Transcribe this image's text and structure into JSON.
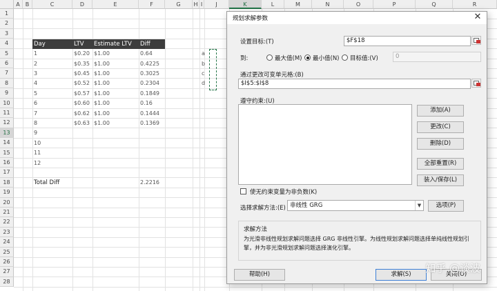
{
  "sheet": {
    "columns": [
      "A",
      "B",
      "C",
      "D",
      "E",
      "F",
      "G",
      "H",
      "I",
      "J",
      "K",
      "L",
      "M",
      "N",
      "O",
      "P",
      "Q",
      "R"
    ],
    "active_column": "K",
    "rows": [
      "1",
      "2",
      "3",
      "4",
      "5",
      "6",
      "7",
      "8",
      "9",
      "10",
      "11",
      "12",
      "13",
      "14",
      "15",
      "16",
      "17",
      "18",
      "19",
      "20",
      "21",
      "22",
      "23",
      "24",
      "25",
      "26",
      "27",
      "28"
    ],
    "active_row": "13",
    "table_headers": [
      "Day",
      "LTV",
      "Estimate LTV",
      "Diff"
    ],
    "table_rows": [
      [
        "1",
        "$0.20",
        "$1.00",
        "0.64"
      ],
      [
        "2",
        "$0.35",
        "$1.00",
        "0.4225"
      ],
      [
        "3",
        "$0.45",
        "$1.00",
        "0.3025"
      ],
      [
        "4",
        "$0.52",
        "$1.00",
        "0.2304"
      ],
      [
        "5",
        "$0.57",
        "$1.00",
        "0.1849"
      ],
      [
        "6",
        "$0.60",
        "$1.00",
        "0.16"
      ],
      [
        "7",
        "$0.62",
        "$1.00",
        "0.1444"
      ],
      [
        "8",
        "$0.63",
        "$1.00",
        "0.1369"
      ],
      [
        "9",
        "",
        "",
        ""
      ],
      [
        "10",
        "",
        "",
        ""
      ],
      [
        "11",
        "",
        "",
        ""
      ],
      [
        "12",
        "",
        "",
        ""
      ]
    ],
    "total_label": "Total Diff",
    "total_value": "2.2216",
    "param_labels": [
      "a",
      "b",
      "c",
      "d"
    ]
  },
  "dialog": {
    "title": "规划求解参数",
    "close_glyph": "✕",
    "set_objective_label": "设置目标:(T)",
    "set_objective_value": "$F$18",
    "to_label": "到:",
    "radio_max": "最大值(M)",
    "radio_min": "最小值(N)",
    "radio_value": "目标值:(V)",
    "selected_radio": "min",
    "target_value": "0",
    "changing_cells_label": "通过更改可变单元格:(B)",
    "changing_cells_value": "$I$5:$I$8",
    "constraints_label": "遵守约束:(U)",
    "btn_add": "添加(A)",
    "btn_change": "更改(C)",
    "btn_delete": "删除(D)",
    "btn_reset": "全部重置(R)",
    "btn_load_save": "装入/保存(L)",
    "nonneg_label": "使无约束变量为非负数(K)",
    "nonneg_checked": false,
    "method_label": "选择求解方法:(E)",
    "method_value": "非线性 GRG",
    "btn_options": "选项(P)",
    "method_group_title": "求解方法",
    "method_desc": "为光滑非线性规划求解问题选择 GRG 非线性引擎。为线性规划求解问题选择单纯线性规划引擎，并为非光滑规划求解问题选择演化引擎。",
    "btn_help": "帮助(H)",
    "btn_solve": "求解(S)",
    "btn_close": "关闭(O)"
  },
  "watermark": "知乎 @谈波",
  "colors": {
    "table_header_bg": "#3d3d3d",
    "excel_green": "#217346",
    "default_button_border": "#3b7ed6"
  },
  "icons": [
    "close-icon",
    "range-select-icon",
    "dropdown-arrow-icon"
  ]
}
